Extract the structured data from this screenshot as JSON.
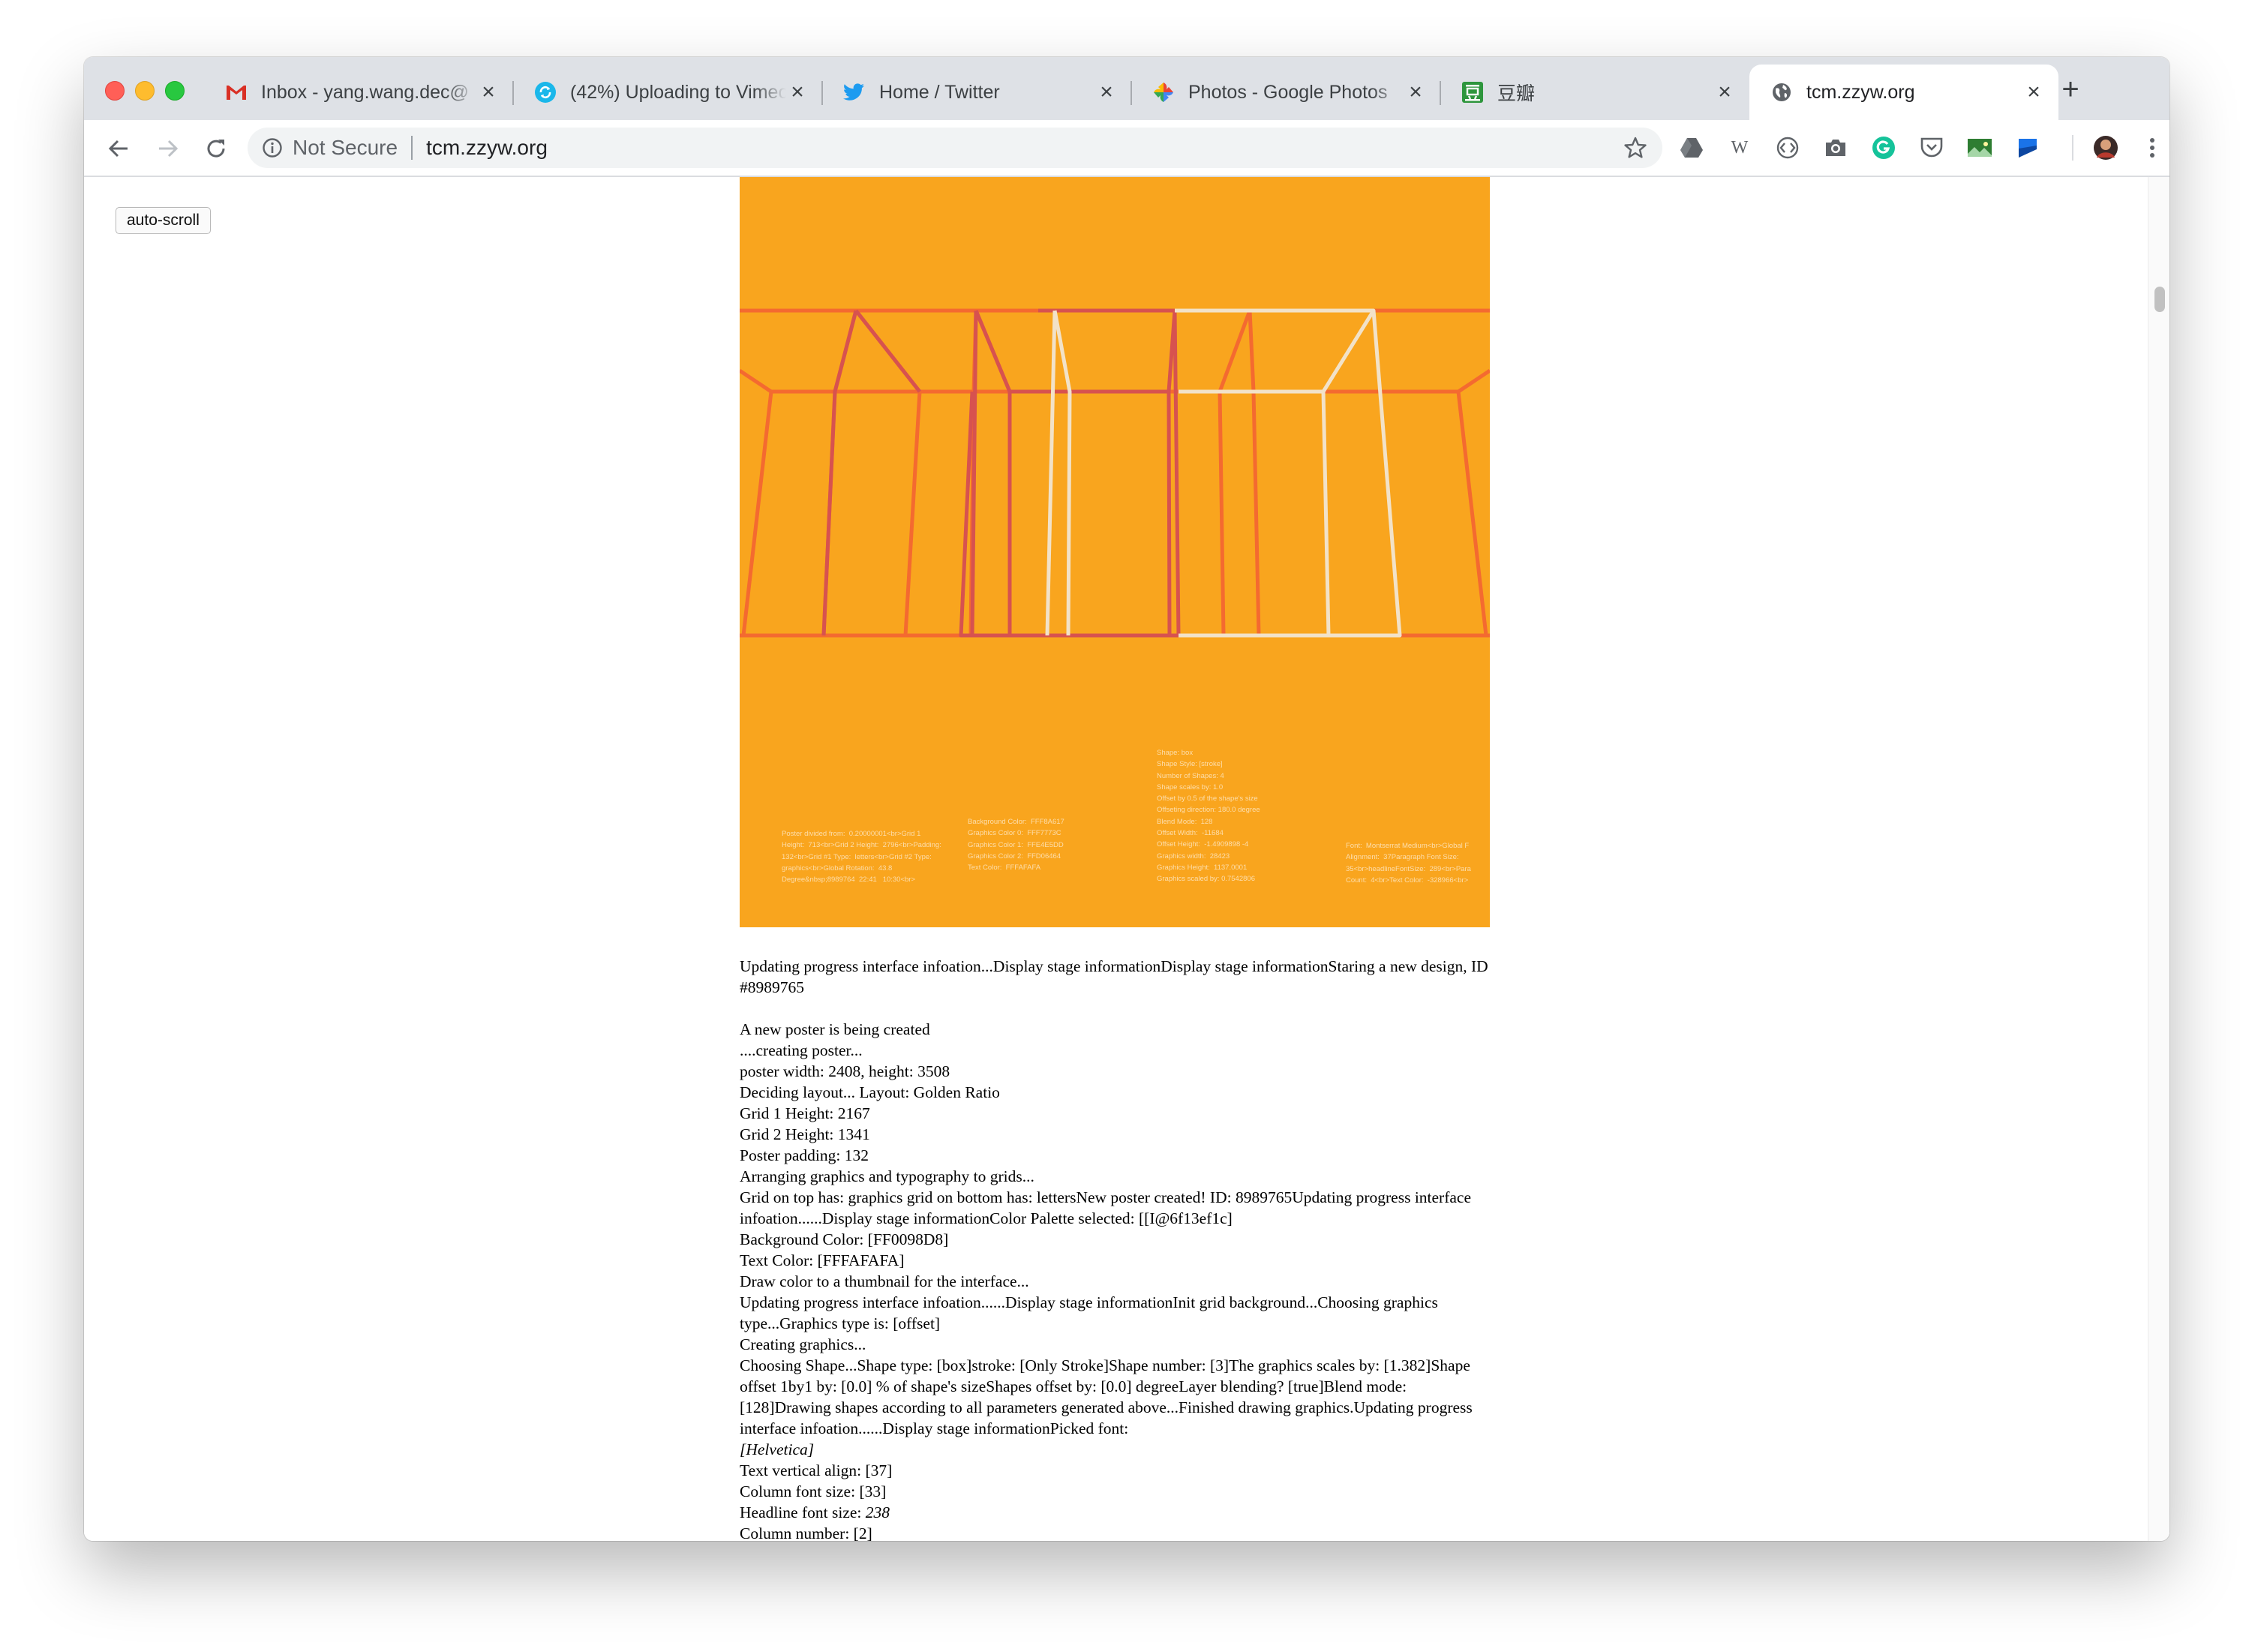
{
  "browser": {
    "tabs": [
      {
        "title": "Inbox - yang.wang.dec@",
        "icon": "gmail-icon",
        "close": "×"
      },
      {
        "title": "(42%) Uploading to Vimeo",
        "icon": "vimeo-upload-icon",
        "close": "×"
      },
      {
        "title": "Home / Twitter",
        "icon": "twitter-icon",
        "close": "×"
      },
      {
        "title": "Photos - Google Photos",
        "icon": "google-photos-icon",
        "close": "×"
      },
      {
        "title": "豆瓣",
        "icon": "douban-icon",
        "close": "×"
      },
      {
        "title": "tcm.zzyw.org",
        "icon": "globe-icon",
        "close": "×",
        "active": true
      }
    ],
    "new_tab": "+",
    "security_label": "Not Secure",
    "url": "tcm.zzyw.org",
    "wikipedia_ext": "W",
    "extensions": [
      "google-drive-icon",
      "wikipedia-icon",
      "code-icon",
      "camera-icon",
      "grammarly-icon",
      "pocket-icon",
      "image-icon",
      "flag-icon",
      "profile-avatar"
    ]
  },
  "page": {
    "auto_scroll_label": "auto-scroll",
    "poster": {
      "background": "#f9a51e",
      "text_blocks": [
        "Poster divided from:  0.20000001<br>Grid 1\nHeight:  713<br>Grid 2 Height:  2796<br>Padding:\n132<br>Grid #1 Type:  letters<br>Grid #2 Type:\ngraphics<br>Global Rotation:  43.8\nDegree&nbsp;8989764  22:41   10:30<br>",
        "Background Color:  FFF8A617\nGraphics Color 0:  FFF7773C\nGraphics Color 1:  FFE4E5DD\nGraphics Color 2:  FFD06464\nText Color:  FFFAFAFA",
        "Shape: box\nShape Style: [stroke]\nNumber of Shapes: 4\nShape scales by: 1.0\nOffset by 0.5 of the shape's size\nOffseting direction: 180.0 degree\nBlend Mode:  128\nOffset Width:  -11684\nOffset Height:  -1.4909898 -4\nGraphics width:  28423\nGraphics Height:  1137.0001\nGraphics scaled by: 0.7542806",
        "Font:  Montserrat Medium<br>Global F\nAlignment:  37Paragraph Font Size:\n35<br>headlineFontSize:  289<br>Para\nCount:  4<br>Text Color:  -328966<br>"
      ]
    },
    "log": [
      {
        "text": "Updating progress interface infoation...Display stage informationDisplay stage informationStaring a new design, ID #8989765"
      },
      {
        "text": ""
      },
      {
        "text": "A new poster is being created"
      },
      {
        "text": "....creating poster..."
      },
      {
        "text": "poster width: 2408, height: 3508"
      },
      {
        "text": "Deciding layout...    Layout:   Golden Ratio"
      },
      {
        "text": "Grid 1 Height: 2167"
      },
      {
        "text": "Grid 2 Height: 1341"
      },
      {
        "text": "Poster padding: 132"
      },
      {
        "text": "Arranging graphics and typography to grids..."
      },
      {
        "text": "Grid on top has: graphics grid on bottom has: lettersNew poster created! ID: 8989765Updating progress interface infoation......Display stage informationColor Palette selected: [[I@6f13ef1c]"
      },
      {
        "text": "Background Color: [FF0098D8]"
      },
      {
        "text": "Text Color: [FFFAFAFA]"
      },
      {
        "text": "Draw color to a thumbnail for the interface..."
      },
      {
        "text": "Updating progress interface infoation......Display stage informationInit grid background...Choosing graphics type...Graphics type is: [offset]"
      },
      {
        "text": "Creating graphics..."
      },
      {
        "text": "Choosing Shape...Shape type: [box]stroke: [Only Stroke]Shape number: [3]The graphics scales by: [1.382]Shape offset 1by1 by: [0.0] % of shape's sizeShapes offset by: [0.0] degreeLayer blending? [true]Blend mode: [128]Drawing shapes according to all parameters generated above...Finished drawing graphics.Updating progress interface infoation......Display stage informationPicked font:"
      },
      {
        "text": "[Helvetica]",
        "italic": true
      },
      {
        "text": "Text vertical align: [37]"
      },
      {
        "text": "Column font size: [33]"
      },
      {
        "text": "Headline font size: ",
        "tail": "238"
      },
      {
        "text": "Column number: [2]"
      }
    ]
  }
}
